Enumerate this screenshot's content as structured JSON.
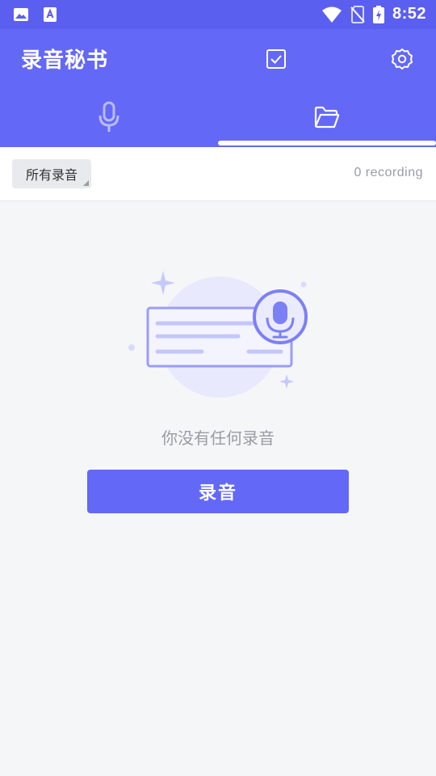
{
  "status_bar": {
    "time": "8:52",
    "left_icons": [
      "image-icon",
      "text-a-icon"
    ],
    "right_icons": [
      "wifi-icon",
      "no-sim-icon",
      "battery-charging-icon"
    ]
  },
  "app_bar": {
    "title": "录音秘书",
    "actions": [
      "checkbox-icon",
      "settings-icon"
    ]
  },
  "tabs": [
    {
      "icon": "microphone-icon",
      "selected": false
    },
    {
      "icon": "folder-icon",
      "selected": true
    }
  ],
  "filter": {
    "label": "所有录音",
    "count_text": "0 recording"
  },
  "empty_state": {
    "illustration": "recording-card-illustration",
    "message": "你没有任何录音",
    "button_label": "录音"
  },
  "colors": {
    "status_bar": "#5b5ff0",
    "primary": "#6468f6",
    "background": "#f5f6f8",
    "muted_text": "#9a9ca3"
  }
}
